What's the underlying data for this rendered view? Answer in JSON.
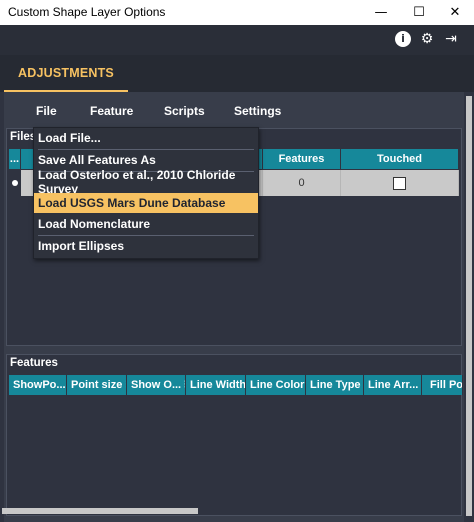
{
  "window": {
    "title": "Custom Shape Layer Options",
    "controls": {
      "minimize": "—",
      "maximize": "☐",
      "close": "✕"
    }
  },
  "toolbar": {
    "icons": [
      "info-icon",
      "gear-icon",
      "sign-out-icon"
    ],
    "info_glyph": "i",
    "gear_glyph": "⚙",
    "signout_glyph": "⇥"
  },
  "tabs": [
    {
      "label": "ADJUSTMENTS",
      "active": true
    }
  ],
  "menubar": {
    "items": [
      "File",
      "Feature",
      "Scripts",
      "Settings"
    ]
  },
  "files_section": {
    "label": "Files",
    "columns": [
      "...",
      "Features",
      "Touched"
    ],
    "rows": [
      {
        "features": "0",
        "touched": false
      }
    ]
  },
  "file_menu": {
    "items": [
      "Load File...",
      "Save All Features As",
      "Load Osterloo et al., 2010 Chloride Survey",
      "Load USGS Mars Dune Database",
      "Load Nomenclature",
      "Import Ellipses"
    ],
    "highlighted_index": 3
  },
  "features_section": {
    "label": "Features",
    "columns": [
      "ShowPo...",
      "Point size",
      "Show O...",
      "Line Width",
      "Line Color",
      "Line Type",
      "Line Arr...",
      "Fill Po"
    ]
  },
  "colors": {
    "accent": "#f7c262",
    "header_teal": "#16889a",
    "panel": "#383d4a",
    "background": "#2f3340"
  }
}
